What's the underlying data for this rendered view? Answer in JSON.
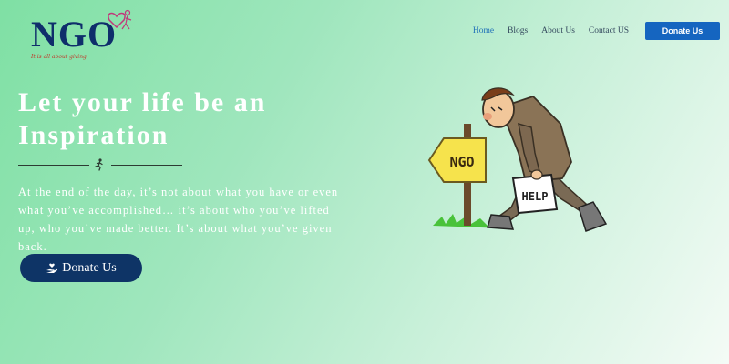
{
  "header": {
    "logo_text": "NGO",
    "logo_tagline": "It is all about giving",
    "nav": [
      {
        "label": "Home",
        "active": true
      },
      {
        "label": "Blogs",
        "active": false
      },
      {
        "label": "About Us",
        "active": false
      },
      {
        "label": "Contact US",
        "active": false
      }
    ],
    "donate_label": "Donate Us"
  },
  "hero": {
    "title": "Let your life be an Inspiration",
    "text": "At the end of the day, it’s not about what you have or even what you’ve accomplished… it’s about who you’ve lifted up, who you’ve made better. It’s about what you’ve given back.",
    "donate_label": "Donate Us",
    "divider_icon": "runner-icon",
    "donate_icon": "hand-heart-icon"
  },
  "illustration": {
    "sign_text": "NGO",
    "help_text": "HELP"
  },
  "colors": {
    "accent": "#1565c0",
    "hero_button": "#0e3466",
    "logo": "#0f2e6b"
  }
}
